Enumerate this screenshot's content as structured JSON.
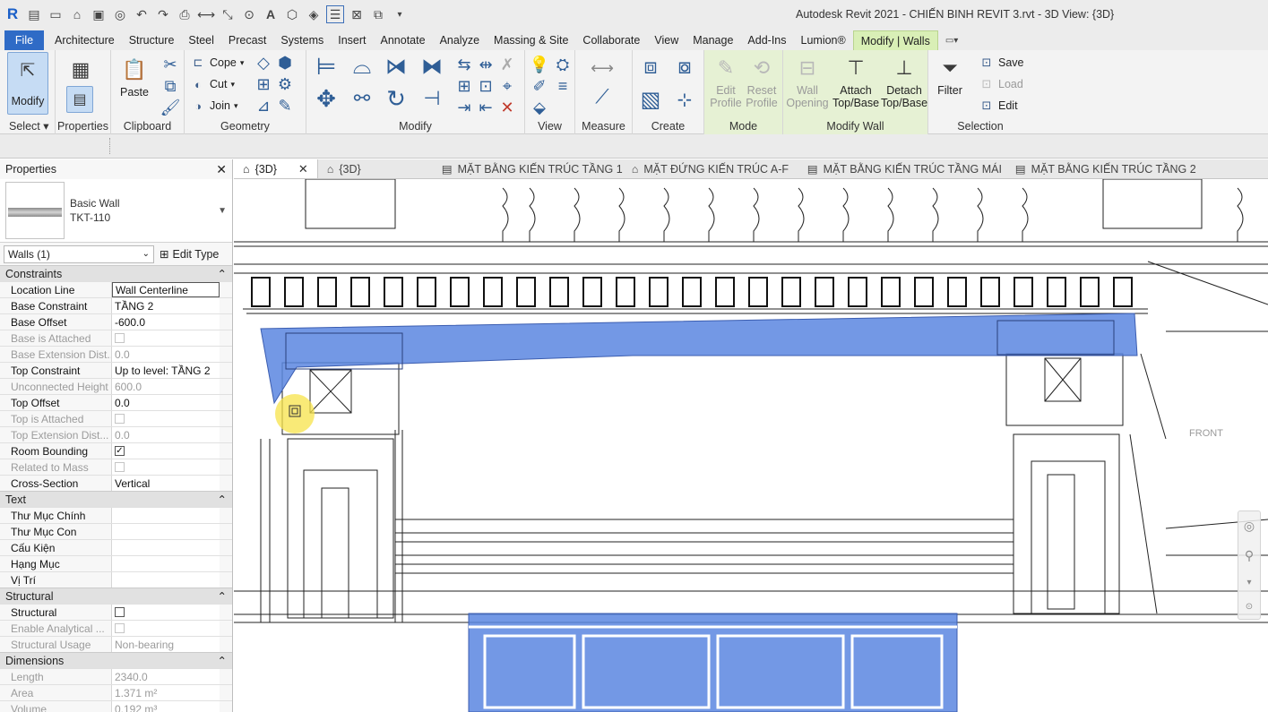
{
  "app": {
    "title": "Autodesk Revit 2021 - CHIẾN BINH REVIT 3.rvt - 3D View: {3D}",
    "logo_letter": "R"
  },
  "ribbon_tabs": [
    {
      "label": "File"
    },
    {
      "label": "Architecture"
    },
    {
      "label": "Structure"
    },
    {
      "label": "Steel"
    },
    {
      "label": "Precast"
    },
    {
      "label": "Systems"
    },
    {
      "label": "Insert"
    },
    {
      "label": "Annotate"
    },
    {
      "label": "Analyze"
    },
    {
      "label": "Massing & Site"
    },
    {
      "label": "Collaborate"
    },
    {
      "label": "View"
    },
    {
      "label": "Manage"
    },
    {
      "label": "Add-Ins"
    },
    {
      "label": "Lumion®"
    },
    {
      "label": "Modify | Walls"
    }
  ],
  "ribbon": {
    "select": {
      "modify": "Modify",
      "group": "Select ▾"
    },
    "properties": {
      "label": "Properties"
    },
    "clipboard": {
      "paste": "Paste",
      "group": "Clipboard"
    },
    "geometry": {
      "cope": "Cope",
      "cut": "Cut",
      "join": "Join",
      "group": "Geometry"
    },
    "modify": {
      "group": "Modify"
    },
    "view": {
      "group": "View"
    },
    "measure": {
      "group": "Measure"
    },
    "create": {
      "group": "Create"
    },
    "mode": {
      "edit_profile_1": "Edit",
      "edit_profile_2": "Profile",
      "reset_profile_1": "Reset",
      "reset_profile_2": "Profile",
      "group": "Mode"
    },
    "modify_wall": {
      "wall_opening_1": "Wall",
      "wall_opening_2": "Opening",
      "attach_1": "Attach",
      "attach_2": "Top/Base",
      "detach_1": "Detach",
      "detach_2": "Top/Base",
      "group": "Modify Wall"
    },
    "selection": {
      "filter": "Filter",
      "save": "Save",
      "load": "Load",
      "edit": "Edit",
      "group": "Selection"
    }
  },
  "properties_palette": {
    "title": "Properties",
    "type_family": "Basic Wall",
    "type_name": "TKT-110",
    "instance_selector": "Walls (1)",
    "edit_type": "Edit Type",
    "sections": {
      "constraints": "Constraints",
      "text": "Text",
      "structural": "Structural",
      "dimensions": "Dimensions"
    },
    "constraints_rows": [
      {
        "name": "Location Line",
        "value": "Wall Centerline"
      },
      {
        "name": "Base Constraint",
        "value": "TẦNG 2"
      },
      {
        "name": "Base Offset",
        "value": "-600.0"
      },
      {
        "name": "Base is Attached",
        "value": ""
      },
      {
        "name": "Base Extension Dist...",
        "value": "0.0"
      },
      {
        "name": "Top Constraint",
        "value": "Up to level: TẦNG 2"
      },
      {
        "name": "Unconnected Height",
        "value": "600.0"
      },
      {
        "name": "Top Offset",
        "value": "0.0"
      },
      {
        "name": "Top is Attached",
        "value": ""
      },
      {
        "name": "Top Extension Dist...",
        "value": "0.0"
      },
      {
        "name": "Room Bounding",
        "value": "✓"
      },
      {
        "name": "Related to Mass",
        "value": ""
      },
      {
        "name": "Cross-Section",
        "value": "Vertical"
      }
    ],
    "text_rows": [
      {
        "name": "Thư Mục Chính",
        "value": ""
      },
      {
        "name": "Thư Mục Con",
        "value": ""
      },
      {
        "name": "Cấu Kiện",
        "value": ""
      },
      {
        "name": "Hạng Mục",
        "value": ""
      },
      {
        "name": "Vị Trí",
        "value": ""
      }
    ],
    "structural_rows": [
      {
        "name": "Structural",
        "value": ""
      },
      {
        "name": "Enable Analytical ...",
        "value": ""
      },
      {
        "name": "Structural Usage",
        "value": "Non-bearing"
      }
    ],
    "dimension_rows": [
      {
        "name": "Length",
        "value": "2340.0"
      },
      {
        "name": "Area",
        "value": "1.371 m²"
      },
      {
        "name": "Volume",
        "value": "0.192 m³"
      }
    ]
  },
  "view_tabs": [
    {
      "label": "{3D}",
      "icon": "3d-view-icon"
    },
    {
      "label": "{3D}",
      "icon": "3d-view-icon"
    },
    {
      "label": "MẶT BẰNG KIẾN TRÚC TẦNG 1",
      "icon": "floor-plan-icon"
    },
    {
      "label": "MẶT ĐỨNG KIẾN TRÚC A-F",
      "icon": "elevation-icon"
    },
    {
      "label": "MẶT BẰNG KIẾN TRÚC TẦNG MÁI",
      "icon": "floor-plan-icon"
    },
    {
      "label": "MẶT BẰNG KIẾN TRÚC TẦNG 2",
      "icon": "floor-plan-icon"
    }
  ],
  "viewcube": {
    "face": "FRONT"
  },
  "colors": {
    "selection_blue": "#5b86e0",
    "modify_tab_green": "#d9efb6",
    "file_tab_blue": "#2f6bc6"
  }
}
